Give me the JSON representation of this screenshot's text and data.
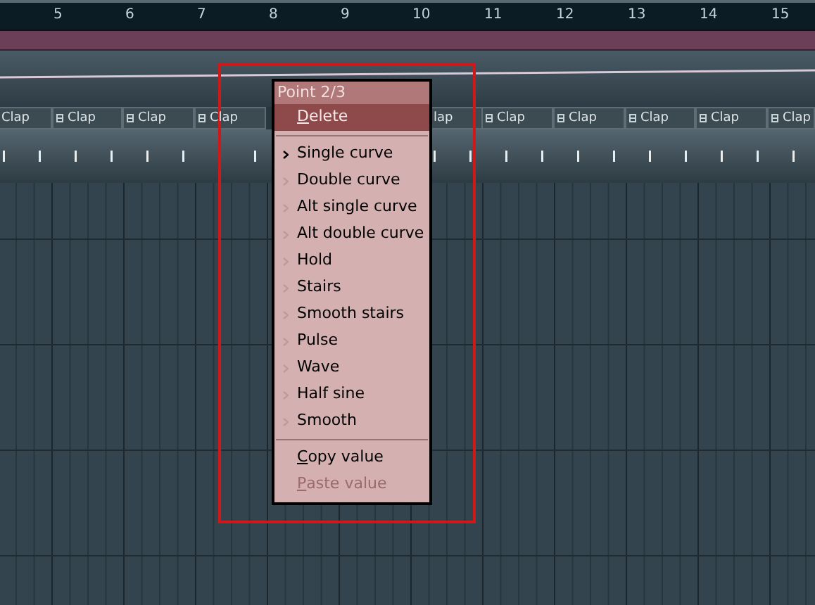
{
  "ruler": {
    "numbers": [
      "5",
      "6",
      "7",
      "8",
      "9",
      "10",
      "11",
      "12",
      "13",
      "14",
      "15"
    ]
  },
  "clap_clips": [
    {
      "label": "Clap"
    },
    {
      "label": "Clap"
    },
    {
      "label": "Clap"
    },
    {
      "label": "Clap"
    },
    {
      "label": "lap"
    },
    {
      "label": "Clap"
    },
    {
      "label": "Clap"
    },
    {
      "label": "Clap"
    },
    {
      "label": "Clap"
    },
    {
      "label": "Clap"
    }
  ],
  "context_menu": {
    "title": "Point 2/3",
    "items": [
      {
        "kind": "action",
        "label": "Delete",
        "highlighted": true,
        "underline_first": true,
        "disabled": false
      },
      {
        "kind": "separator"
      },
      {
        "kind": "curve",
        "label": "Single curve",
        "selected": true
      },
      {
        "kind": "curve",
        "label": "Double curve",
        "selected": false
      },
      {
        "kind": "curve",
        "label": "Alt single curve",
        "selected": false
      },
      {
        "kind": "curve",
        "label": "Alt double curve",
        "selected": false
      },
      {
        "kind": "curve",
        "label": "Hold",
        "selected": false
      },
      {
        "kind": "curve",
        "label": "Stairs",
        "selected": false
      },
      {
        "kind": "curve",
        "label": "Smooth stairs",
        "selected": false
      },
      {
        "kind": "curve",
        "label": "Pulse",
        "selected": false
      },
      {
        "kind": "curve",
        "label": "Wave",
        "selected": false
      },
      {
        "kind": "curve",
        "label": "Half sine",
        "selected": false
      },
      {
        "kind": "curve",
        "label": "Smooth",
        "selected": false
      },
      {
        "kind": "separator"
      },
      {
        "kind": "action",
        "label": "Copy value",
        "highlighted": false,
        "underline_first": true,
        "disabled": false
      },
      {
        "kind": "action",
        "label": "Paste value",
        "highlighted": false,
        "underline_first": true,
        "disabled": true
      }
    ]
  }
}
